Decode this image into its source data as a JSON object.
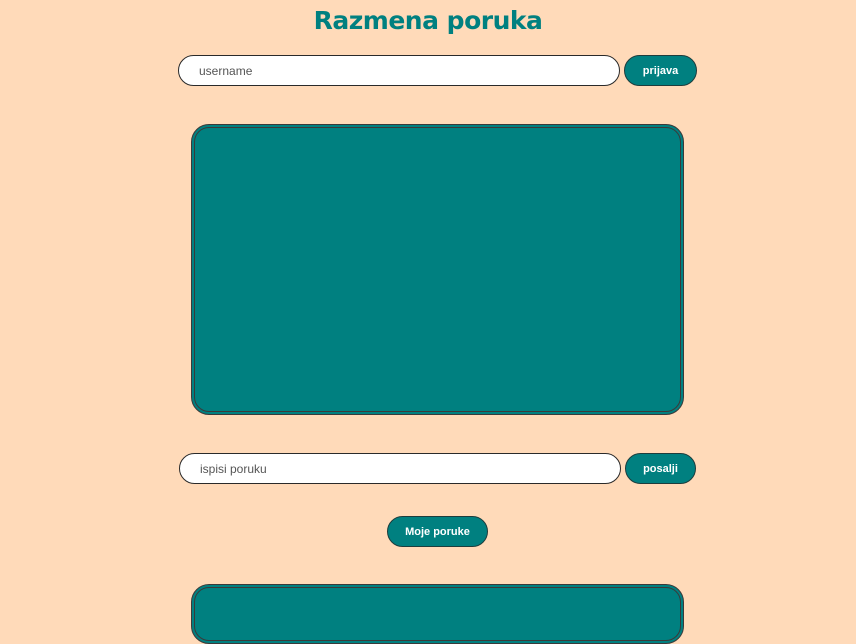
{
  "page": {
    "title": "Razmena poruka",
    "colors": {
      "background": "#FFDAB9",
      "accent": "#008080"
    }
  },
  "login": {
    "username_placeholder": "username",
    "username_value": "",
    "login_button_label": "prijava"
  },
  "compose": {
    "message_placeholder": "ispisi poruku",
    "message_value": "",
    "send_button_label": "posalji"
  },
  "my_messages": {
    "button_label": "Moje poruke"
  }
}
